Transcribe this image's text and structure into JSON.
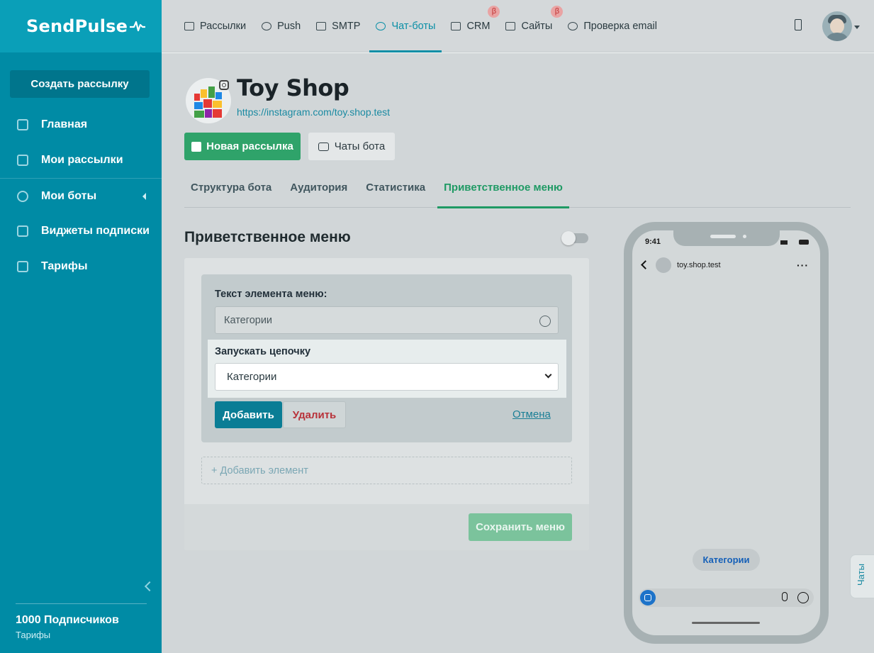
{
  "brand": {
    "name": "SendPulse"
  },
  "sidebar": {
    "create_label": "Создать рассылку",
    "items": [
      {
        "label": "Главная",
        "icon": "sliders-icon"
      },
      {
        "label": "Мои рассылки",
        "icon": "upload-box-icon"
      },
      {
        "label": "Мои боты",
        "icon": "globe-icon"
      },
      {
        "label": "Виджеты подписки",
        "icon": "download-box-icon"
      },
      {
        "label": "Тарифы",
        "icon": "wallet-icon"
      }
    ],
    "subscribers": "1000 Подписчиков",
    "plan_link": "Тарифы"
  },
  "topnav": {
    "items": [
      {
        "label": "Рассылки",
        "icon": "mail-icon"
      },
      {
        "label": "Push",
        "icon": "bell-icon"
      },
      {
        "label": "SMTP",
        "icon": "code-icon"
      },
      {
        "label": "Чат-боты",
        "icon": "chatbot-icon",
        "active": true
      },
      {
        "label": "CRM",
        "icon": "crm-icon",
        "badge": "β"
      },
      {
        "label": "Сайты",
        "icon": "sites-icon",
        "badge": "β"
      },
      {
        "label": "Проверка email",
        "icon": "check-circle-icon"
      }
    ]
  },
  "bot": {
    "name": "Toy Shop",
    "link": "https://instagram.com/toy.shop.test"
  },
  "actions": {
    "new_campaign": "Новая рассылка",
    "bot_chats": "Чаты бота"
  },
  "tabs": [
    {
      "label": "Структура бота"
    },
    {
      "label": "Аудитория"
    },
    {
      "label": "Статистика"
    },
    {
      "label": "Приветственное меню",
      "active": true
    }
  ],
  "welcome_menu": {
    "title": "Приветственное меню",
    "enabled": false,
    "item_text_label": "Текст элемента меню:",
    "item_text_value": "Категории",
    "chain_label": "Запускать цепочку",
    "chain_value": "Категории",
    "add_label": "Добавить",
    "delete_label": "Удалить",
    "cancel_label": "Отмена",
    "add_element_label": "+ Добавить элемент",
    "save_label": "Сохранить меню"
  },
  "preview": {
    "time": "9:41",
    "chat_name": "toy.shop.test",
    "quick_reply": "Категории"
  },
  "chats_tab": "Чаты",
  "colors": {
    "sidebar": "#008ba5",
    "accent": "#0a8fa6",
    "green": "#2fa36a",
    "danger": "#b8323a",
    "beta_badge": "#e9a3a3"
  }
}
